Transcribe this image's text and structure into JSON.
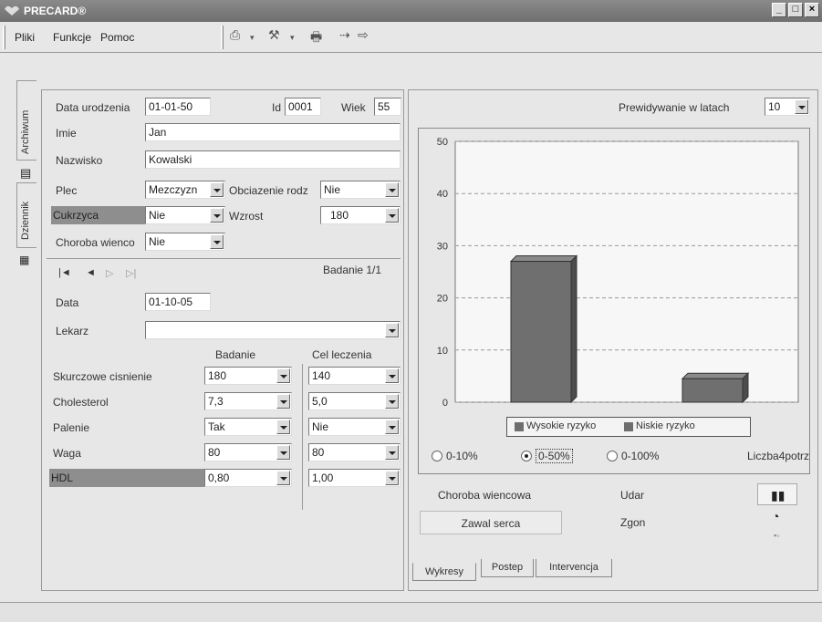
{
  "app": {
    "title": "PRECARD®"
  },
  "window_controls": {
    "minimize": "_",
    "maximize": "□",
    "close": "×"
  },
  "menu": {
    "items": [
      "Pliki",
      "Funkcje",
      "Pomoc"
    ]
  },
  "side_tabs": [
    "Archiwum",
    "Dziennik"
  ],
  "patient": {
    "birth_label": "Data urodzenia",
    "birth_value": "01-01-50",
    "id_label": "Id",
    "id_value": "0001",
    "age_label": "Wiek",
    "age_value": "55",
    "first_name_label": "Imie",
    "first_name_value": "Jan",
    "last_name_label": "Nazwisko",
    "last_name_value": "Kowalski",
    "sex_label": "Plec",
    "sex_value": "Mezczyzn",
    "family_label": "Obciazenie rodz",
    "family_value": "Nie",
    "diabetes_label": "Cukrzyca",
    "diabetes_value": "Nie",
    "height_label": "Wzrost",
    "height_value": "180",
    "cad_label": "Choroba wienco",
    "cad_value": "Nie"
  },
  "exam": {
    "nav": [
      "|◄",
      "◄",
      "▷",
      "▷|"
    ],
    "counter": "Badanie  1/1",
    "date_label": "Data",
    "date_value": "01-10-05",
    "doctor_label": "Lekarz",
    "doctor_value": "",
    "col_exam": "Badanie",
    "col_target": "Cel leczenia",
    "rows": [
      {
        "label": "Skurczowe cisnienie",
        "exam": "180",
        "target": "140"
      },
      {
        "label": "Cholesterol",
        "exam": "7,3",
        "target": "5,0"
      },
      {
        "label": "Palenie",
        "exam": "Tak",
        "target": "Nie"
      },
      {
        "label": "Waga",
        "exam": "80",
        "target": "80"
      },
      {
        "label": "HDL",
        "exam": "0,80",
        "target": "1,00"
      }
    ]
  },
  "prediction": {
    "label": "Prewidywanie w latach",
    "value": "10"
  },
  "chart_data": {
    "type": "bar",
    "categories": [
      "Wysokie ryzyko",
      "Niskie ryzyko"
    ],
    "values": [
      27,
      4.5
    ],
    "ylim": [
      0,
      50
    ],
    "yticks": [
      "0",
      "10",
      "20",
      "30",
      "40",
      "50"
    ],
    "legend": [
      "Wysokie ryzyko",
      "Niskie ryzyko"
    ],
    "grid": true
  },
  "scale_options": [
    "0-10%",
    "0-50%",
    "0-100%"
  ],
  "selected_scale": "0-50%",
  "liczba_label": "Liczba4potrz",
  "outcomes": {
    "cad": "Choroba wiencowa",
    "stroke": "Udar",
    "mi": "Zawal serca",
    "death": "Zgon"
  },
  "bottom_tabs": [
    "Wykresy",
    "Postep",
    "Intervencja"
  ],
  "colors": {
    "bar": "#6f6f6f",
    "bar_top": "#8a8a8a",
    "dark_label": "#8e8e8e"
  }
}
